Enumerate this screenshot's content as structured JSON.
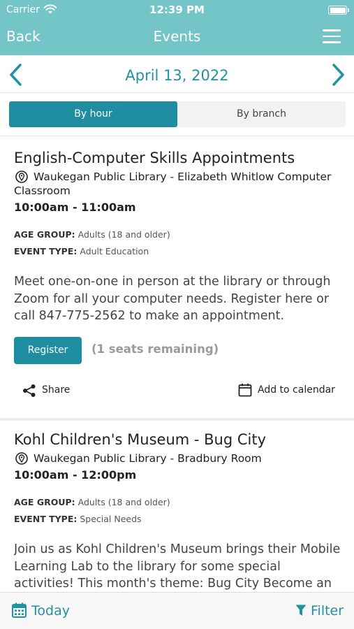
{
  "status_bar": {
    "carrier": "Carrier",
    "time": "12:39 PM"
  },
  "nav": {
    "back_label": "Back",
    "title": "Events",
    "menu_icon": "hamburger-menu-icon"
  },
  "date_bar": {
    "date": "April 13, 2022",
    "prev_icon": "chevron-left-icon",
    "next_icon": "chevron-right-icon"
  },
  "view_toggle": {
    "options": [
      {
        "label": "By hour",
        "selected": true
      },
      {
        "label": "By branch",
        "selected": false
      }
    ]
  },
  "events": [
    {
      "title": "English-Computer Skills Appointments",
      "location": "Waukegan Public Library - Elizabeth Whitlow Computer Classroom",
      "time": "10:00am - 11:00am",
      "age_group_label": "AGE GROUP:",
      "age_group": "Adults (18 and older)",
      "event_type_label": "EVENT TYPE:",
      "event_type": "Adult Education",
      "description": "Meet one-on-one in person at the library or through Zoom for all your computer needs.  Register here or call 847-775-2562 to make an appointment.",
      "register_label": "Register",
      "seats_text": "(1 seats remaining)",
      "share_label": "Share",
      "calendar_label": "Add to calendar"
    },
    {
      "title": "Kohl Children's Museum - Bug City",
      "location": "Waukegan Public Library - Bradbury Room",
      "time": "10:00am - 12:00pm",
      "age_group_label": "AGE GROUP:",
      "age_group": "Adults (18 and older)",
      "event_type_label": "EVENT TYPE:",
      "event_type": "Special Needs",
      "description": "Join us as Kohl Children's Museum brings their Mobile Learning Lab to the library for some special activities! This month's theme: Bug City Become an"
    }
  ],
  "toolbar": {
    "today_label": "Today",
    "filter_label": "Filter"
  },
  "colors": {
    "header_bg": "#73c5c7",
    "accent": "#1f8ea2",
    "accent_text": "#1e93a3"
  }
}
